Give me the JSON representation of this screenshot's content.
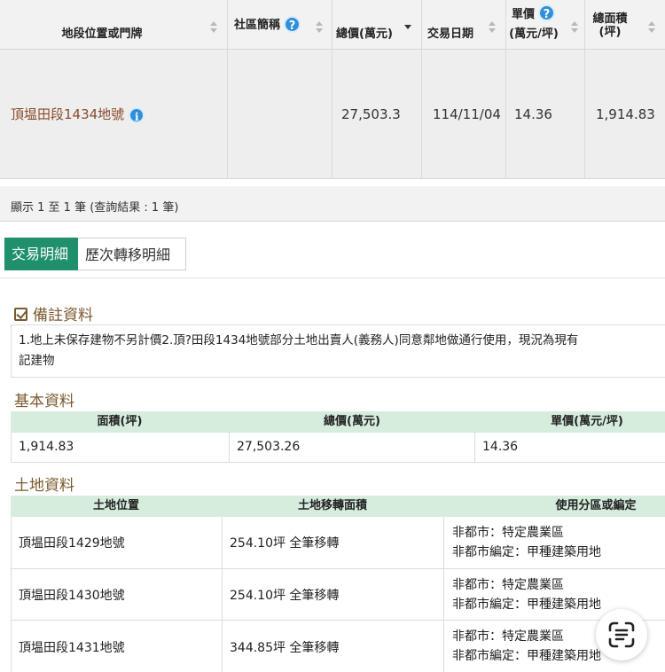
{
  "results": {
    "headers": {
      "location": "地段位置或門牌",
      "community": "社區簡稱",
      "total_price": "總價(萬元)",
      "date": "交易日期",
      "unit_price_1": "單價",
      "unit_price_2": "(萬元/坪)",
      "area_1": "總面積",
      "area_2": "(坪)"
    },
    "row": {
      "location": "頂塭田段1434地號",
      "community": "",
      "total_price": "27,503.3",
      "date": "114/11/04",
      "unit_price": "14.36",
      "area": "1,914.83"
    },
    "count_text": "顯示 1 至 1 筆 (查詢結果 : 1 筆)"
  },
  "tabs": [
    "交易明細",
    "歷次轉移明細"
  ],
  "remarks": {
    "title": "備註資料",
    "line1": "1.地上未保存建物不另計價2.頂?田段1434地號部分土地出賣人(義務人)同意鄰地做通行使用，現況為現有",
    "line2": "記建物"
  },
  "basic": {
    "title": "基本資料",
    "headers": [
      "面積(坪)",
      "總價(萬元)",
      "單價(萬元/坪)"
    ],
    "values": [
      "1,914.83",
      "27,503.26",
      "14.36"
    ]
  },
  "land": {
    "title": "土地資料",
    "headers": [
      "土地位置",
      "土地移轉面積",
      "使用分區或編定"
    ],
    "rows": [
      {
        "location": "頂塭田段1429地號",
        "area": "254.10坪 全筆移轉",
        "zone1": "非都市：特定農業區",
        "zone2": "非都市編定：甲種建築用地"
      },
      {
        "location": "頂塭田段1430地號",
        "area": "254.10坪 全筆移轉",
        "zone1": "非都市：特定農業區",
        "zone2": "非都市編定：甲種建築用地"
      },
      {
        "location": "頂塭田段1431地號",
        "area": "344.85坪 全筆移轉",
        "zone1": "非都市：特定農業區",
        "zone2": "非都市編定：甲種建築用地"
      }
    ]
  },
  "icons": {
    "help": "question-circle-icon",
    "info": "info-circle-icon",
    "sort": "sort-arrows-icon",
    "check": "checkbox-icon",
    "scan": "text-scan-icon"
  },
  "colors": {
    "tab_active": "#1f8f6c",
    "table_header_green": "#d6ecdc",
    "section_title": "#7a5a2e",
    "link": "#8a4b2a",
    "icon_blue": "#2f8fd8"
  }
}
